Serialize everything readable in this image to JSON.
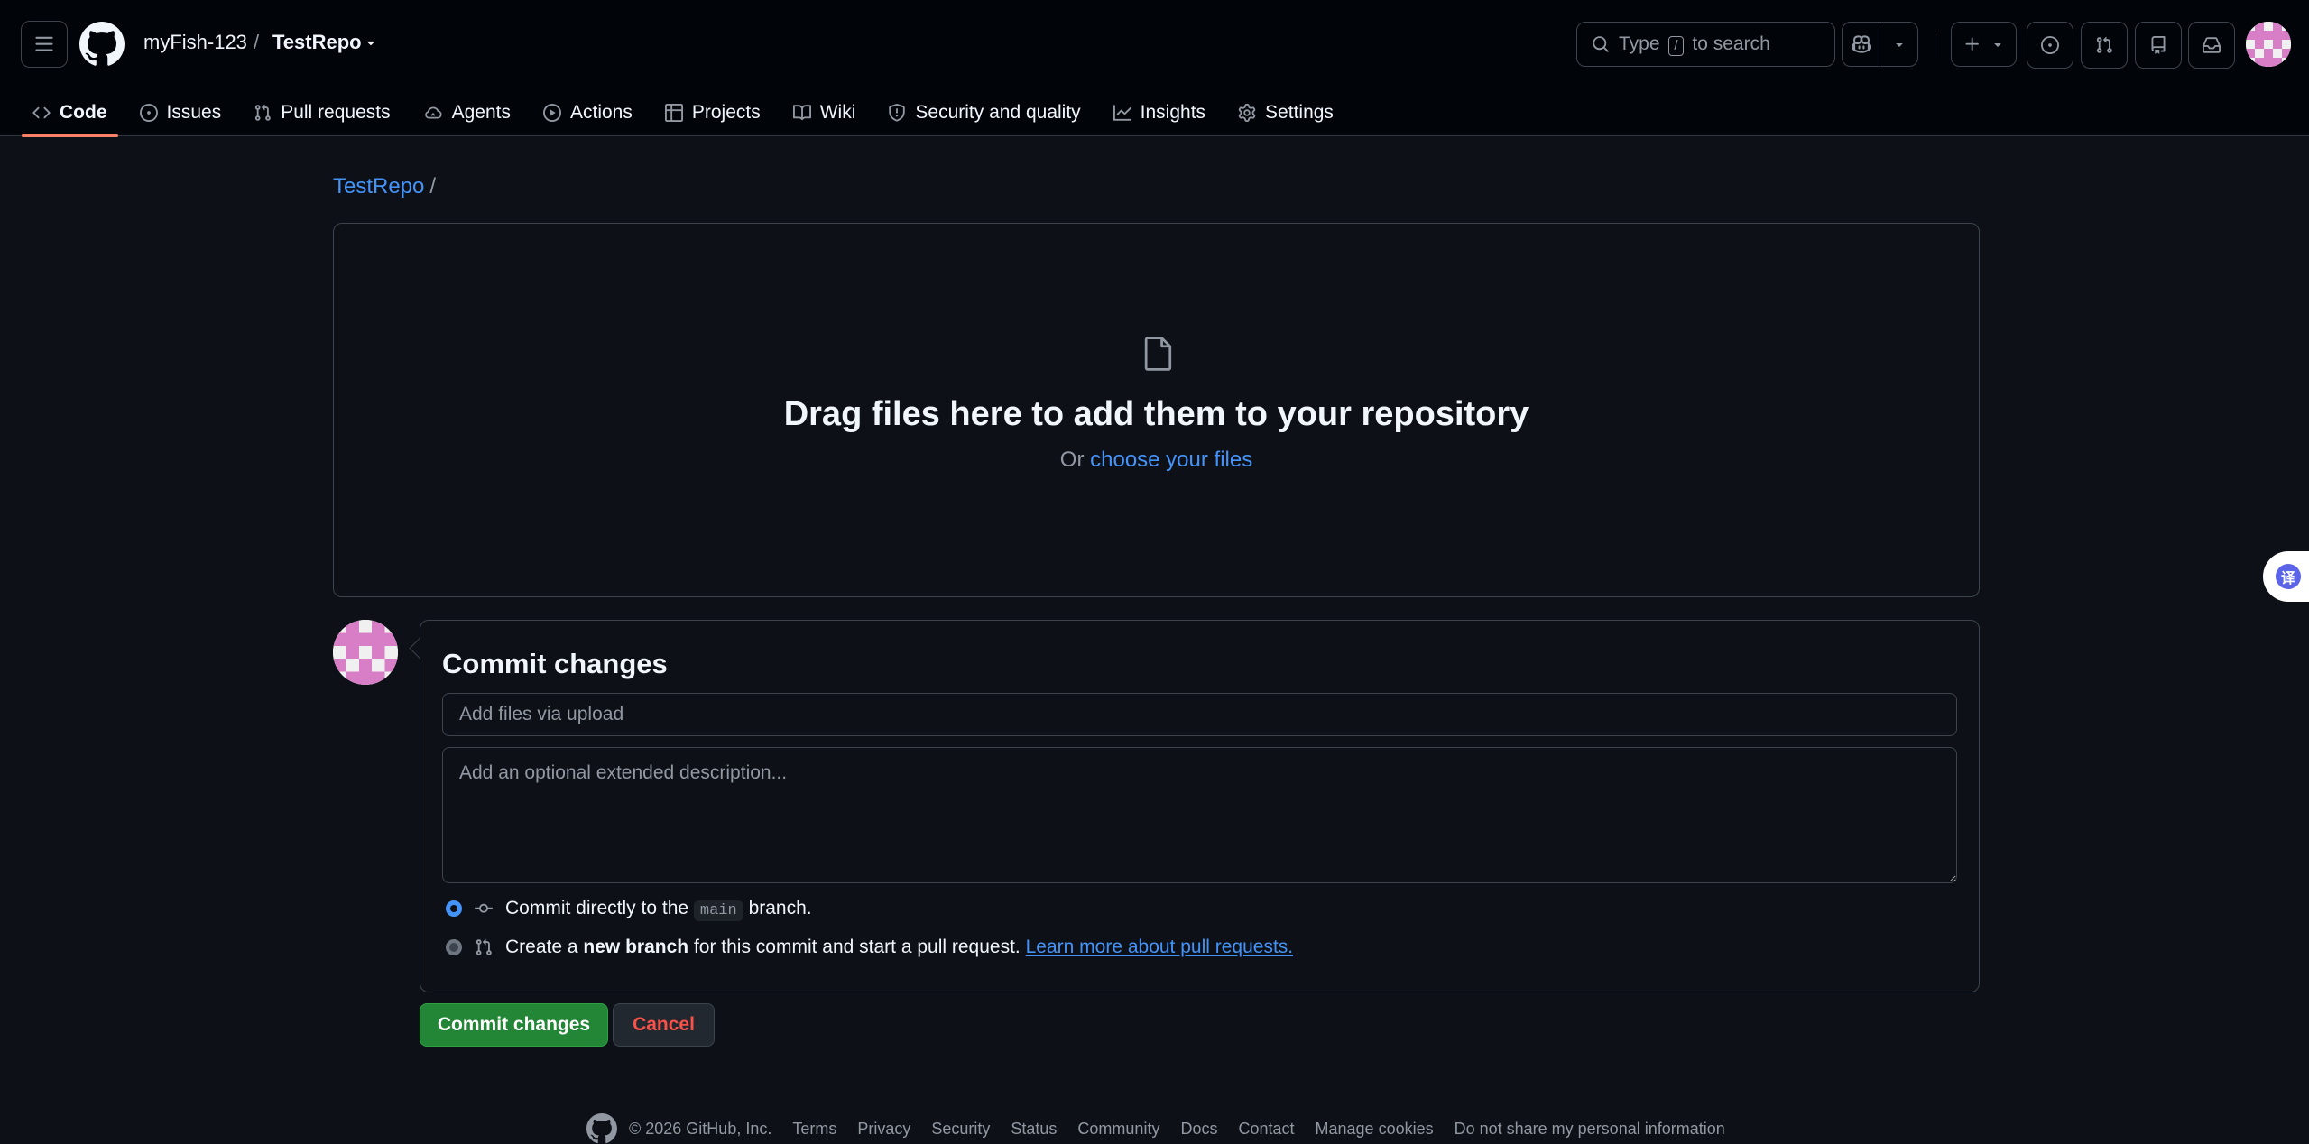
{
  "header": {
    "owner": "myFish-123",
    "separator": "/",
    "repo": "TestRepo",
    "search": {
      "prefix": "Type",
      "key": "/",
      "suffix": "to search"
    }
  },
  "nav": {
    "items": [
      {
        "label": "Code",
        "icon": "code-icon",
        "active": true
      },
      {
        "label": "Issues",
        "icon": "issue-opened-icon"
      },
      {
        "label": "Pull requests",
        "icon": "git-pull-request-icon"
      },
      {
        "label": "Agents",
        "icon": "agent-cloud-icon"
      },
      {
        "label": "Actions",
        "icon": "play-icon"
      },
      {
        "label": "Projects",
        "icon": "table-icon"
      },
      {
        "label": "Wiki",
        "icon": "book-icon"
      },
      {
        "label": "Security and quality",
        "icon": "shield-icon"
      },
      {
        "label": "Insights",
        "icon": "graph-icon"
      },
      {
        "label": "Settings",
        "icon": "gear-icon"
      }
    ]
  },
  "breadcrumb": {
    "repo": "TestRepo",
    "slash": "/"
  },
  "dropzone": {
    "title": "Drag files here to add them to your repository",
    "or": "Or",
    "choose": "choose your files"
  },
  "commit": {
    "title": "Commit changes",
    "summary_placeholder": "Add files via upload",
    "description_placeholder": "Add an optional extended description...",
    "option_direct": {
      "prefix": "Commit directly to the",
      "branch": "main",
      "suffix": "branch."
    },
    "option_new": {
      "prefix": "Create a",
      "bold": "new branch",
      "suffix": "for this commit and start a pull request.",
      "link": "Learn more about pull requests."
    },
    "submit_label": "Commit changes",
    "cancel_label": "Cancel"
  },
  "footer": {
    "copyright": "© 2026 GitHub, Inc.",
    "links": [
      "Terms",
      "Privacy",
      "Security",
      "Status",
      "Community",
      "Docs",
      "Contact",
      "Manage cookies",
      "Do not share my personal information"
    ]
  },
  "side_widget": {
    "glyph": "译"
  },
  "colors": {
    "background": "#0d1117",
    "header": "#010409",
    "accent_link": "#4493f8",
    "primary_button": "#238636",
    "danger_text": "#f85149",
    "active_tab": "#f78166"
  }
}
